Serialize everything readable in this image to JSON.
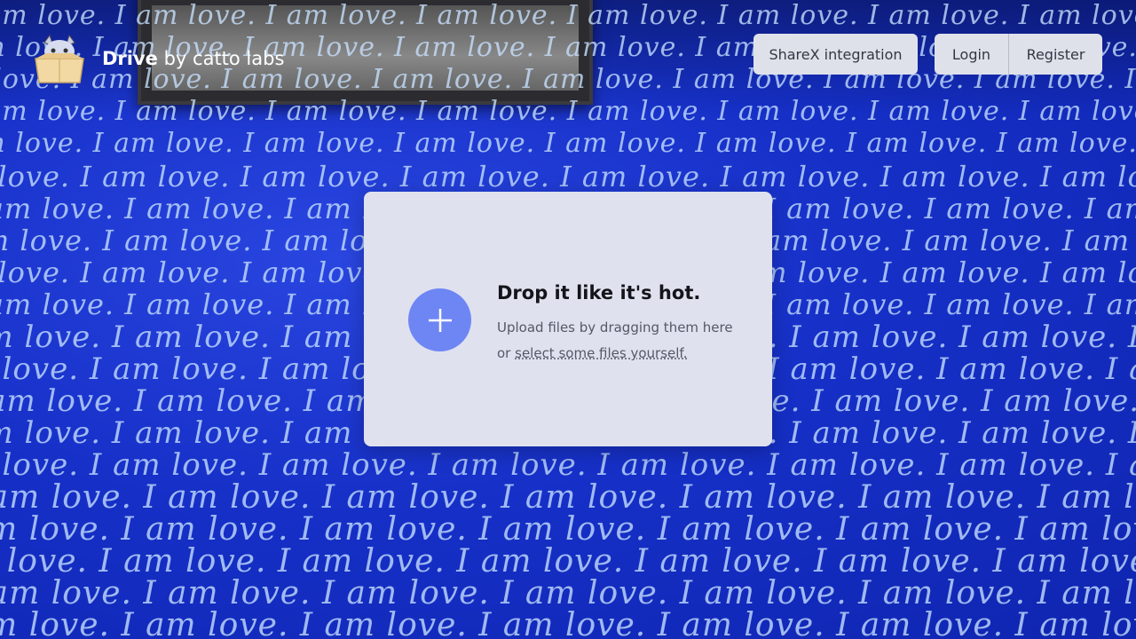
{
  "brand": {
    "name_bold": "Drive",
    "name_rest": " by catto labs",
    "logo_icon": "cat-in-box-icon"
  },
  "header": {
    "sharex_label": "ShareX integration",
    "login_label": "Login",
    "register_label": "Register"
  },
  "dropzone": {
    "title": "Drop it like it's hot.",
    "subtitle": "Upload files by dragging them here",
    "or_text": "or ",
    "select_link": "select some files yourself.",
    "icon": "plus-icon"
  },
  "background": {
    "wall_text": "I am love."
  },
  "colors": {
    "accent": "#6e86f4",
    "wall_blue": "#1a2fc0",
    "card_bg": "#dfe1ee",
    "button_bg": "#dfe1ea"
  }
}
